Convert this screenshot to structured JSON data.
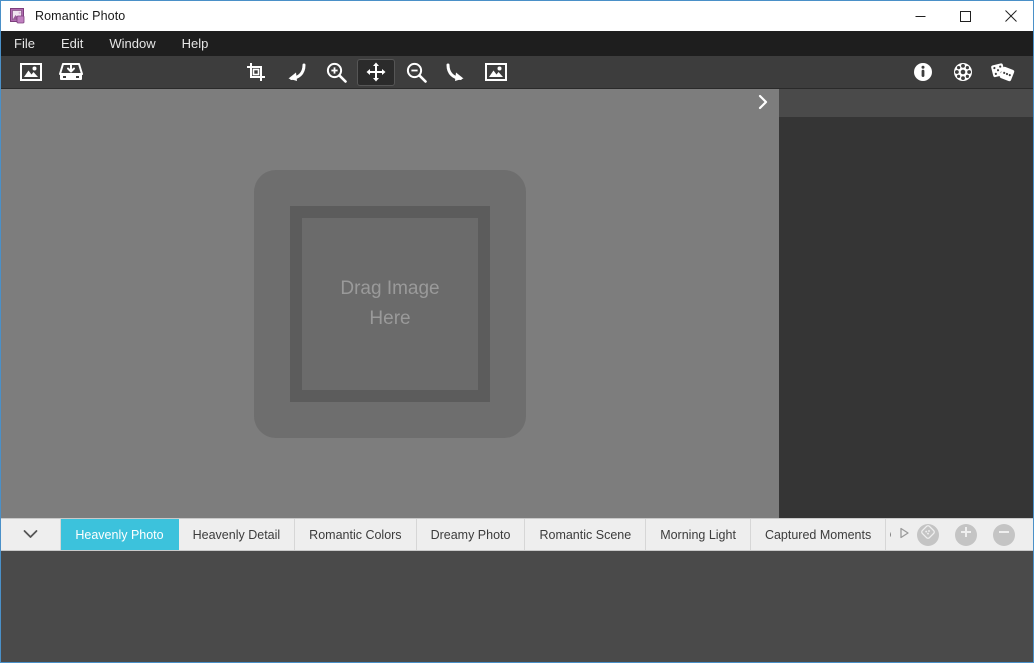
{
  "window": {
    "title": "Romantic Photo",
    "app_icon": "photo-app-icon",
    "controls": {
      "minimize": "minimize-icon",
      "maximize": "maximize-icon",
      "close": "close-icon"
    }
  },
  "menubar": {
    "items": [
      {
        "label": "File"
      },
      {
        "label": "Edit"
      },
      {
        "label": "Window"
      },
      {
        "label": "Help"
      }
    ]
  },
  "toolbar": {
    "groups": [
      {
        "buttons": [
          {
            "name": "open-image-button",
            "icon": "image-icon",
            "active": false
          },
          {
            "name": "save-image-button",
            "icon": "save-tray-icon",
            "active": false
          }
        ]
      },
      {
        "buttons": [
          {
            "name": "crop-button",
            "icon": "crop-icon",
            "active": false
          },
          {
            "name": "undo-button",
            "icon": "undo-arrow-icon",
            "active": false
          },
          {
            "name": "zoom-in-button",
            "icon": "zoom-in-icon",
            "active": false
          },
          {
            "name": "pan-button",
            "icon": "move-arrows-icon",
            "active": true
          },
          {
            "name": "zoom-out-button",
            "icon": "zoom-out-icon",
            "active": false
          },
          {
            "name": "redo-button",
            "icon": "redo-arrow-icon",
            "active": false
          },
          {
            "name": "fit-image-button",
            "icon": "fit-image-icon",
            "active": false
          }
        ]
      },
      {
        "buttons": [
          {
            "name": "info-button",
            "icon": "info-icon",
            "active": false
          },
          {
            "name": "settings-button",
            "icon": "gear-icon",
            "active": false
          },
          {
            "name": "random-effect-button",
            "icon": "dice-icon",
            "active": false
          }
        ]
      }
    ]
  },
  "canvas": {
    "dropzone_text": "Drag Image\nHere",
    "panel_toggle_icon": "chevron-right-icon",
    "background_color": "#7d7d7d"
  },
  "sidepanel": {
    "background_color": "#353535",
    "header_color": "#4a4a4a"
  },
  "effects_bar": {
    "dropdown_icon": "chevron-down-icon",
    "scroll_next_icon": "triangle-right-icon",
    "active_color": "#3cc2dc",
    "tabs": [
      {
        "label": "Heavenly Photo",
        "active": true
      },
      {
        "label": "Heavenly Detail",
        "active": false
      },
      {
        "label": "Romantic Colors",
        "active": false
      },
      {
        "label": "Dreamy Photo",
        "active": false
      },
      {
        "label": "Romantic Scene",
        "active": false
      },
      {
        "label": "Morning Light",
        "active": false
      },
      {
        "label": "Captured Moments",
        "active": false
      },
      {
        "label": "C",
        "active": false,
        "clipped": true
      }
    ],
    "actions": [
      {
        "name": "palette-button",
        "icon": "palette-icon"
      },
      {
        "name": "add-effect-button",
        "icon": "plus-icon"
      },
      {
        "name": "remove-effect-button",
        "icon": "minus-icon"
      }
    ]
  },
  "filmstrip": {
    "background_color": "#4a4a4a",
    "items": []
  }
}
